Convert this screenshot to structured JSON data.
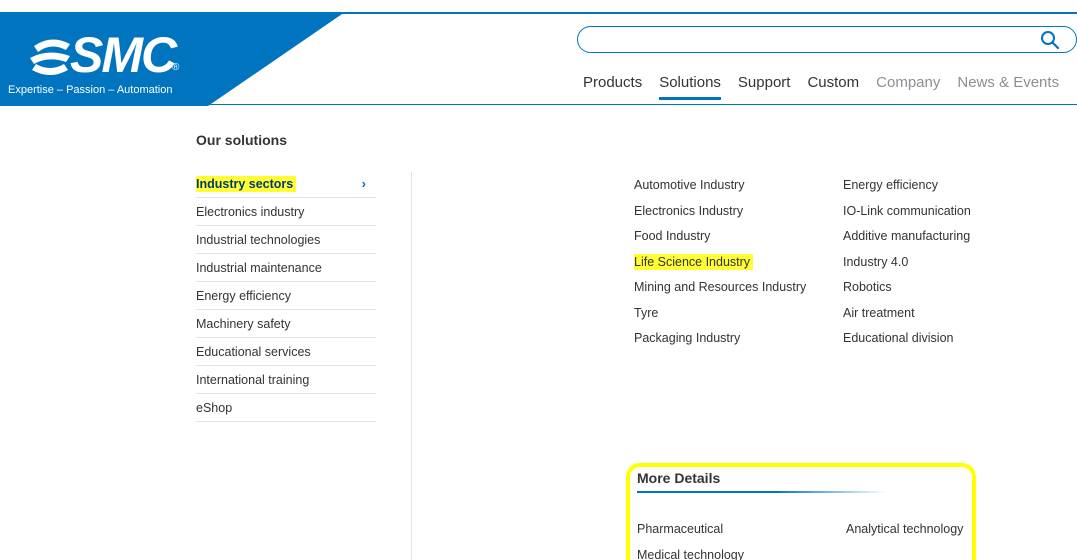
{
  "header": {
    "logo_text": "SMC",
    "logo_reg": "®",
    "tagline": "Expertise – Passion – Automation",
    "search": {
      "value": "",
      "placeholder": ""
    },
    "nav": [
      {
        "label": "Products",
        "state": "normal"
      },
      {
        "label": "Solutions",
        "state": "active"
      },
      {
        "label": "Support",
        "state": "normal"
      },
      {
        "label": "Custom",
        "state": "normal"
      },
      {
        "label": "Company",
        "state": "muted"
      },
      {
        "label": "News & Events",
        "state": "muted"
      }
    ]
  },
  "sidebar": {
    "title": "Our solutions",
    "items": [
      {
        "label": "Industry sectors",
        "active": true,
        "chevron": "›"
      },
      {
        "label": "Electronics industry"
      },
      {
        "label": "Industrial technologies"
      },
      {
        "label": "Industrial maintenance"
      },
      {
        "label": "Energy efficiency"
      },
      {
        "label": "Machinery safety"
      },
      {
        "label": "Educational services"
      },
      {
        "label": "International training"
      },
      {
        "label": "eShop"
      }
    ]
  },
  "sectors": {
    "column1": [
      "Automotive Industry",
      "Electronics Industry",
      "Food Industry",
      "Life Science Industry",
      "Mining and Resources Industry",
      "Tyre",
      "Packaging Industry"
    ],
    "column2": [
      "Energy efficiency",
      "IO-Link communication",
      "Additive manufacturing",
      "Industry 4.0",
      "Robotics",
      "Air treatment",
      "Educational division"
    ],
    "highlighted": "Life Science Industry"
  },
  "more_details": {
    "title": "More Details",
    "items": [
      "Pharmaceutical",
      "Analytical technology",
      "Medical technology"
    ]
  },
  "colors": {
    "brand_blue": "#0074be",
    "highlight_yellow": "#ffff33"
  }
}
